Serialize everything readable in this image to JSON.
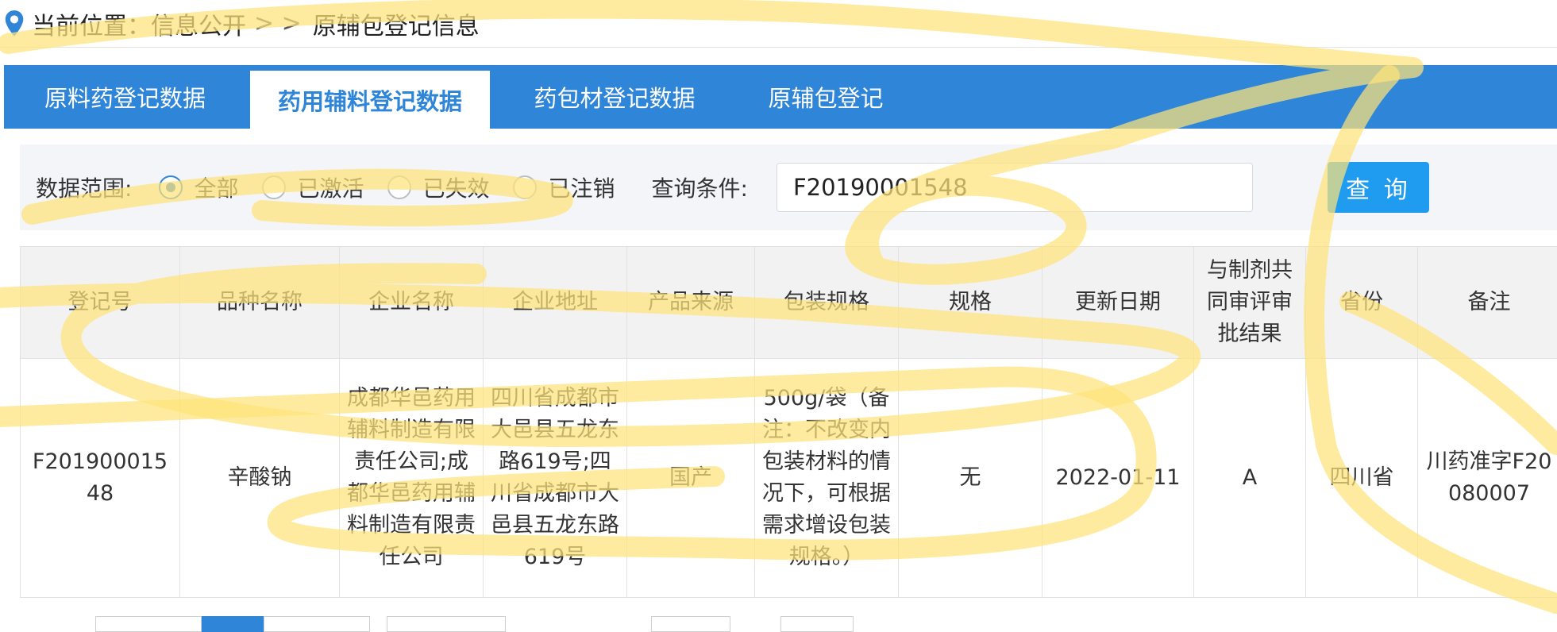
{
  "breadcrumb": {
    "prefix": "当前位置：",
    "section": "信息公开",
    "separator": "> >",
    "current": "原辅包登记信息"
  },
  "tabs": [
    {
      "label": "原料药登记数据",
      "active": false
    },
    {
      "label": "药用辅料登记数据",
      "active": true
    },
    {
      "label": "药包材登记数据",
      "active": false
    },
    {
      "label": "原辅包登记",
      "active": false
    }
  ],
  "filter": {
    "range_label": "数据范围:",
    "options": [
      {
        "label": "全部",
        "checked": true
      },
      {
        "label": "已激活",
        "checked": false
      },
      {
        "label": "已失效",
        "checked": false
      },
      {
        "label": "已注销",
        "checked": false
      }
    ],
    "condition_label": "查询条件:",
    "query_value": "F20190001548",
    "query_button": "查 询"
  },
  "table": {
    "headers": [
      "登记号",
      "品种名称",
      "企业名称",
      "企业地址",
      "产品来源",
      "包装规格",
      "规格",
      "更新日期",
      "与制剂共同审评审批结果",
      "省份",
      "备注"
    ],
    "rows": [
      [
        "F20190001548",
        "辛酸钠",
        "成都华邑药用辅料制造有限责任公司;成都华邑药用辅料制造有限责任公司",
        "四川省成都市大邑县五龙东路619号;四川省成都市大邑县五龙东路619号",
        "国产",
        "500g/袋（备注：不改变内包装材料的情况下，可根据需求增设包装规格。）",
        "无",
        "2022-01-11",
        "A",
        "四川省",
        "川药准字F20080007"
      ]
    ]
  },
  "colors": {
    "tab_bar": "#2f85d8",
    "accent": "#2f85d8",
    "button": "#1f9cf0",
    "highlight_scribble": "#fde37a"
  },
  "icons": {
    "breadcrumb": "location-pin-icon"
  }
}
